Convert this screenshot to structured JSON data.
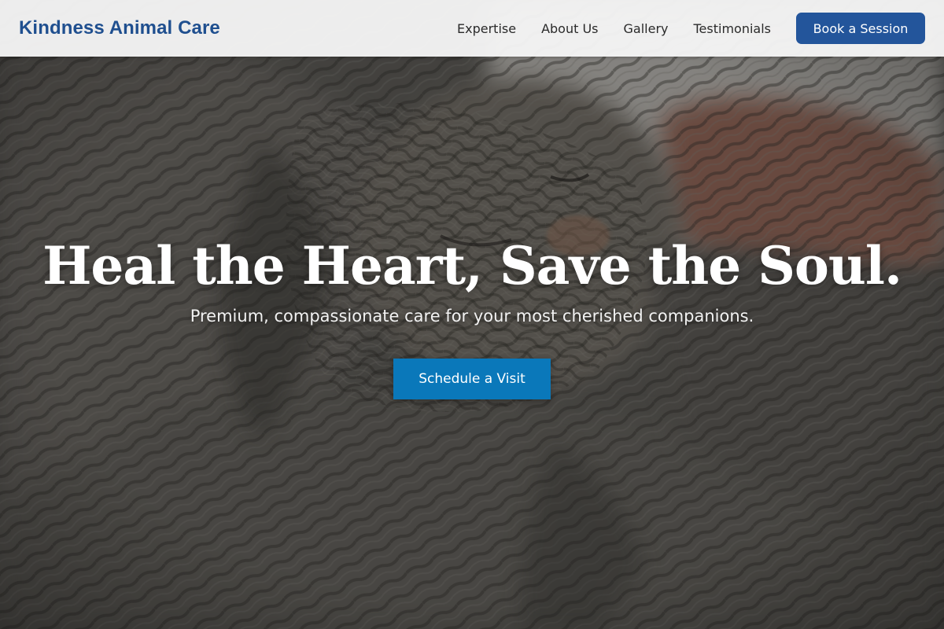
{
  "brand": {
    "name": "Kindness Animal Care",
    "color": "#1f4f8f"
  },
  "nav": {
    "links": [
      {
        "label": "Expertise"
      },
      {
        "label": "About Us"
      },
      {
        "label": "Gallery"
      },
      {
        "label": "Testimonials"
      }
    ],
    "book_button": "Book a Session",
    "book_button_color": "#23559b"
  },
  "hero": {
    "background": "photo of two tabby cats cuddling",
    "headline": "Heal the Heart, Save the Soul.",
    "subheadline": "Premium, compassionate care for your most cherished companions.",
    "cta_button": "Schedule a Visit",
    "cta_color": "#0a78ba"
  }
}
